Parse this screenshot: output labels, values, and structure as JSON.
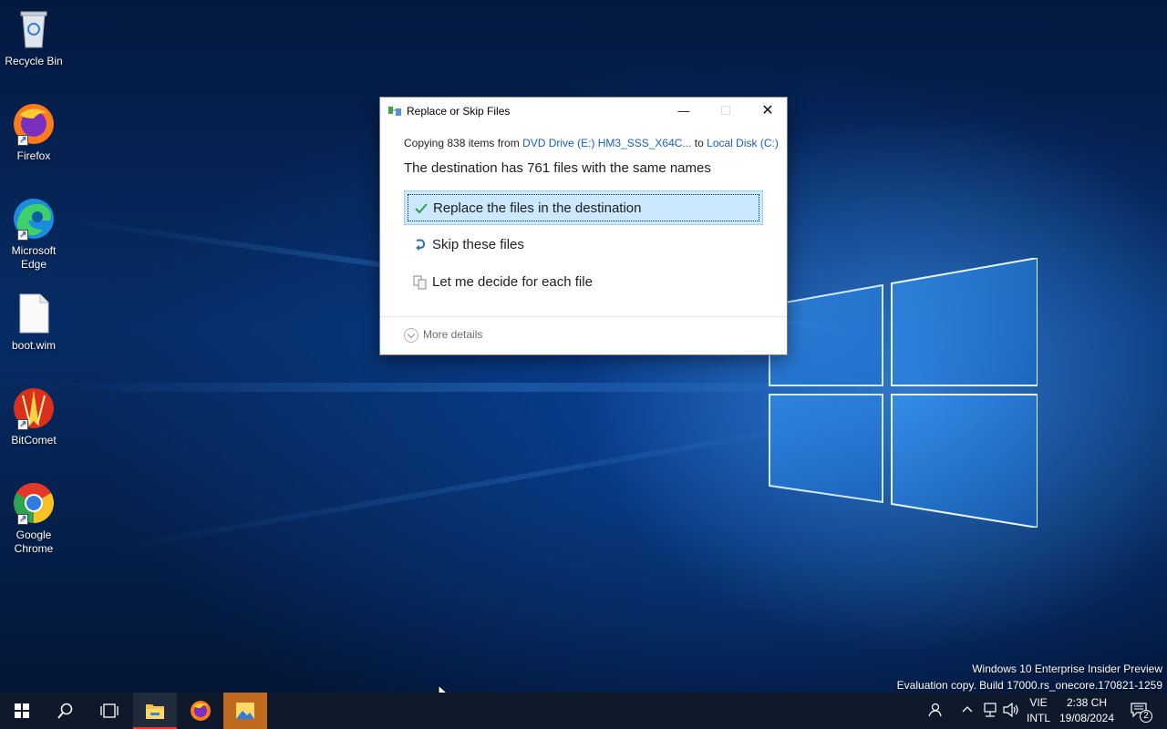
{
  "desktop": {
    "icons": [
      {
        "label": "Recycle Bin",
        "icon": "recycle-bin-icon"
      },
      {
        "label": "Firefox",
        "icon": "firefox-icon"
      },
      {
        "label": "Microsoft Edge",
        "icon": "edge-icon"
      },
      {
        "label": "boot.wim",
        "icon": "file-icon"
      },
      {
        "label": "BitComet",
        "icon": "bitcomet-icon"
      },
      {
        "label": "Google Chrome",
        "icon": "chrome-icon"
      }
    ],
    "watermark": {
      "line1": "Windows 10 Enterprise Insider Preview",
      "line2": "Evaluation copy. Build 17000.rs_onecore.170821-1259"
    }
  },
  "dialog": {
    "title": "Replace or Skip Files",
    "copy": {
      "prefix": "Copying 838 items from ",
      "source": "DVD Drive (E:) HM3_SSS_X64C...",
      "mid": " to ",
      "destination": "Local Disk (C:)"
    },
    "heading": "The destination has 761 files with the same names",
    "options": [
      {
        "label": "Replace the files in the destination",
        "icon": "check-icon",
        "selected": true
      },
      {
        "label": "Skip these files",
        "icon": "skip-icon",
        "selected": false
      },
      {
        "label": "Let me decide for each file",
        "icon": "compare-icon",
        "selected": false
      }
    ],
    "more_details": "More details"
  },
  "taskbar": {
    "language": {
      "line1": "VIE",
      "line2": "INTL"
    },
    "time": "2:38 CH",
    "date": "19/08/2024",
    "notification_count": "2"
  },
  "colors": {
    "accent": "#0078d7",
    "selection_bg": "#cce8ff",
    "link": "#1560bd",
    "taskbar": "#0e1a2b"
  }
}
